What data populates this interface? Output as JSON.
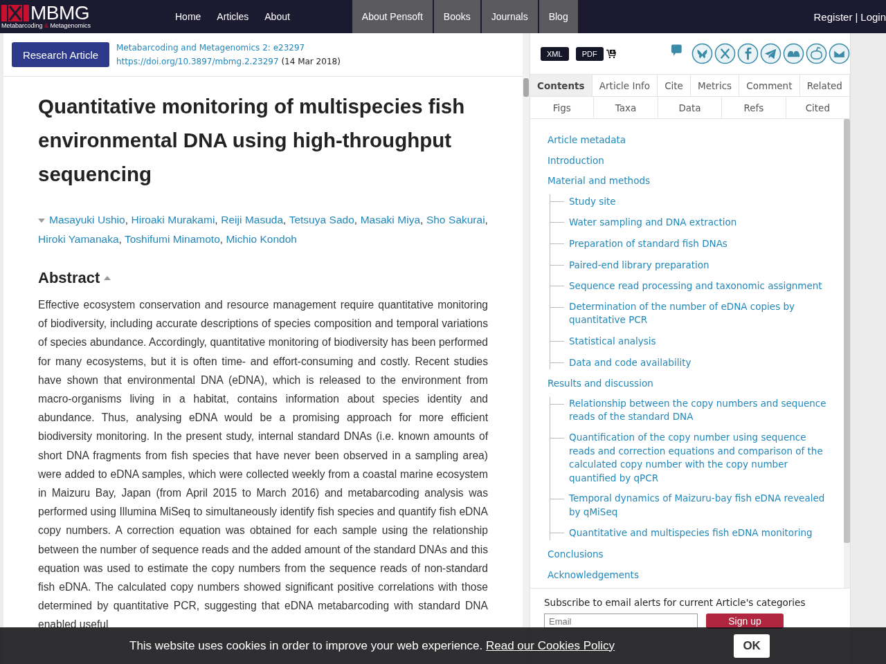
{
  "header": {
    "logo": {
      "text": "MBMG",
      "tagline_left": "Metabarcoding",
      "ampersand": "&",
      "tagline_right": "Metagenomics"
    },
    "nav": [
      {
        "label": "Home",
        "kind": "plain"
      },
      {
        "label": "Articles",
        "kind": "plain"
      },
      {
        "label": "About",
        "kind": "plain"
      },
      {
        "label": "About Pensoft",
        "kind": "boxed"
      },
      {
        "label": "Books",
        "kind": "boxed"
      },
      {
        "label": "Journals",
        "kind": "boxed"
      },
      {
        "label": "Blog",
        "kind": "boxed"
      }
    ],
    "account": {
      "register": "Register",
      "separator": "|",
      "login": "Login"
    }
  },
  "article": {
    "type_button": "Research Article",
    "journal": "Metabarcoding and Metagenomics 2: e23297",
    "doi": "https://doi.org/10.3897/mbmg.2.23297",
    "date": "(14 Mar 2018)",
    "title": "Quantitative monitoring of multispecies fish environmental DNA using high-throughput sequencing",
    "authors_expanded": true,
    "author_separator": ",",
    "authors": [
      "Masayuki Ushio",
      "Hiroaki Murakami",
      "Reiji Masuda",
      "Tetsuya Sado",
      "Masaki Miya",
      "Sho Sakurai",
      "Hiroki Yamanaka",
      "Toshifumi Minamoto",
      "Michio Kondoh"
    ],
    "abstract_heading": "Abstract",
    "abstract_expanded": true,
    "abstract": "Effective ecosystem conservation and resource management require quantitative monitoring of biodiversity, including accurate descriptions of species composition and temporal variations of species abundance. Accordingly, quantitative monitoring of biodiversity has been performed for many ecosystems, but it is often time- and effort-consuming and costly. Recent studies have shown that environmental DNA (eDNA), which is released to the environment from macro-organisms living in a habitat, contains information about species identity and abundance. Thus, analysing eDNA would be a promising approach for more efficient biodiversity monitoring. In the present study, internal standard DNAs (i.e. known amounts of short DNA fragments from fish species that have never been observed in a sampling area) were added to eDNA samples, which were collected weekly from a coastal marine ecosystem in Maizuru Bay, Japan (from April 2015 to March 2016) and metabarcoding analysis was performed using Illumina MiSeq to simultaneously identify fish species and quantify fish eDNA copy numbers. A correction equation was obtained for each sample using the relationship between the number of sequence reads and the added amount of the standard DNAs and this equation was used to estimate the copy numbers from the sequence reads of non-standard fish eDNA. The calculated copy numbers showed significant positive correlations with those determined by quantitative PCR, suggesting that eDNA metabarcoding with standard DNA enabled useful"
  },
  "sidebar": {
    "downloads": [
      "XML",
      "PDF"
    ],
    "tabs_row_1": [
      {
        "label": "Contents",
        "selected": true
      },
      {
        "label": "Article Info",
        "selected": false
      },
      {
        "label": "Cite",
        "selected": false
      },
      {
        "label": "Metrics",
        "selected": false
      },
      {
        "label": "Comment",
        "selected": false
      },
      {
        "label": "Related",
        "selected": false
      }
    ],
    "tabs_row_2": [
      {
        "label": "Figs",
        "selected": false
      },
      {
        "label": "Taxa",
        "selected": false
      },
      {
        "label": "Data",
        "selected": false
      },
      {
        "label": "Refs",
        "selected": false
      },
      {
        "label": "Cited",
        "selected": false
      }
    ],
    "contents": [
      {
        "label": "Article metadata"
      },
      {
        "label": "Introduction"
      },
      {
        "label": "Material and methods",
        "children": [
          {
            "label": "Study site"
          },
          {
            "label": "Water sampling and DNA extraction"
          },
          {
            "label": "Preparation of standard fish DNAs"
          },
          {
            "label": "Paired-end library preparation"
          },
          {
            "label": "Sequence read processing and taxonomic assignment"
          },
          {
            "label": "Determination of the number of eDNA copies by quantitative PCR"
          },
          {
            "label": "Statistical analysis"
          },
          {
            "label": "Data and code availability"
          }
        ]
      },
      {
        "label": "Results and discussion",
        "children": [
          {
            "label": "Relationship between the copy numbers and sequence reads of the standard DNA"
          },
          {
            "label": "Quantification of the copy number using sequence reads and correction equations and comparison of the calculated copy number with the copy number quantified by qPCR"
          },
          {
            "label": "Temporal dynamics of Maizuru-bay fish eDNA revealed by qMiSeq"
          },
          {
            "label": "Quantitative and multispecies fish eDNA monitoring"
          }
        ]
      },
      {
        "label": "Conclusions"
      },
      {
        "label": "Acknowledgements"
      }
    ],
    "subscribe": {
      "text": "Subscribe to email alerts for current Article's categories",
      "placeholder": "Email",
      "button": "Sign up"
    }
  },
  "cookie_banner": {
    "text": "This website uses cookies in order to improve your web experience.",
    "link": "Read our Cookies Policy",
    "button": "OK"
  }
}
